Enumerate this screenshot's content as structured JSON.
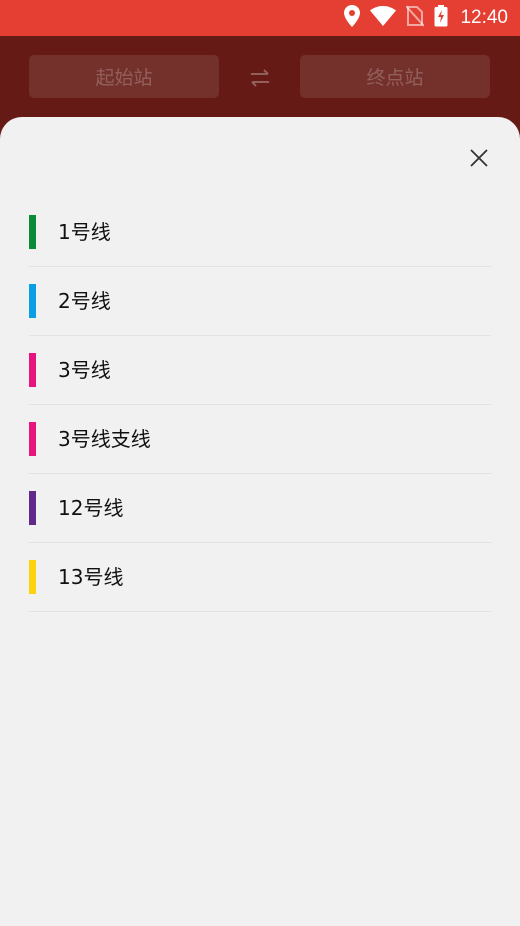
{
  "status_bar": {
    "time": "12:40",
    "icons": [
      "location-icon",
      "wifi-icon",
      "no-sim-icon",
      "battery-charging-icon"
    ]
  },
  "route_bar": {
    "start_label": "起始站",
    "end_label": "终点站",
    "swap_icon": "swap-icon"
  },
  "sheet": {
    "close_icon": "close-icon",
    "lines": [
      {
        "label": "1号线",
        "color": "#0b8a3a"
      },
      {
        "label": "2号线",
        "color": "#0a9fe4"
      },
      {
        "label": "3号线",
        "color": "#e9137e"
      },
      {
        "label": "3号线支线",
        "color": "#e9137e"
      },
      {
        "label": "12号线",
        "color": "#62288a"
      },
      {
        "label": "13号线",
        "color": "#fdd20f"
      }
    ]
  },
  "colors": {
    "status_bar_bg": "#e53f33",
    "app_bar_bg": "#651a15",
    "sheet_bg": "#f1f1f1"
  }
}
